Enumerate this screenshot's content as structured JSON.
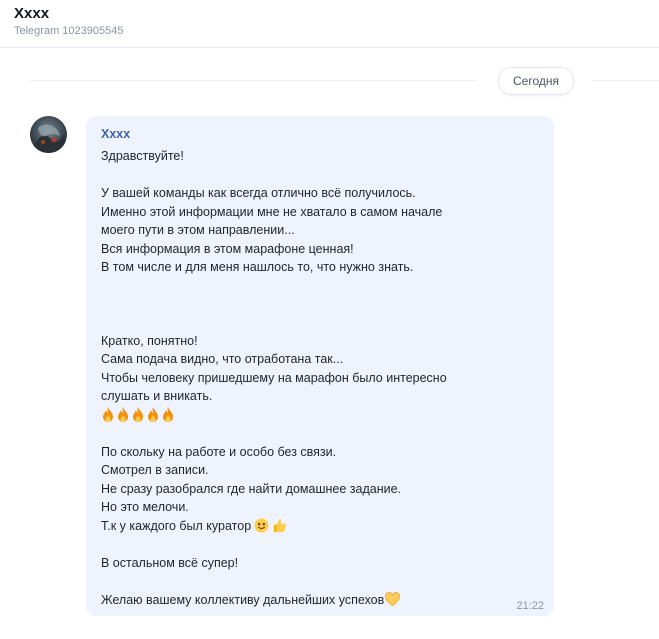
{
  "header": {
    "title": "Xxxx",
    "subtitle": "Telegram 1023905545"
  },
  "date_separator": "Сегодня",
  "message": {
    "sender": "Xxxx",
    "time": "21:22",
    "lines": [
      "Здравствуйте!",
      "У вашей команды как всегда отлично всё получилось.",
      "Именно этой информации мне не хватало в самом начале",
      "моего пути в этом направлении...",
      "Вся информация в этом марафоне ценная!",
      "В том числе и для меня нашлось то, что нужно знать.",
      "Кратко, понятно!",
      "Сама подача видно, что отработана так...",
      "Чтобы человеку пришедшему на марафон было интересно",
      "слушать и вникать.",
      "По скольку на работе и особо без связи.",
      "Смотрел в записи.",
      "Не сразу разобрался где найти домашнее задание.",
      "Но это мелочи.",
      "Т.к у каждого был куратор",
      "В остальном всё супер!",
      " Желаю вашему коллективу дальнейших успехов"
    ],
    "emoji": {
      "fire_row": [
        "fire-icon",
        "fire-icon",
        "fire-icon",
        "fire-icon",
        "fire-icon"
      ],
      "curator_line": [
        "smiling-face-icon",
        "thumbs-up-icon"
      ],
      "closing": "yellow-heart-icon"
    }
  },
  "colors": {
    "bubble": "#eef3fd",
    "sender": "#3f63a8",
    "muted": "#8a94a6"
  }
}
